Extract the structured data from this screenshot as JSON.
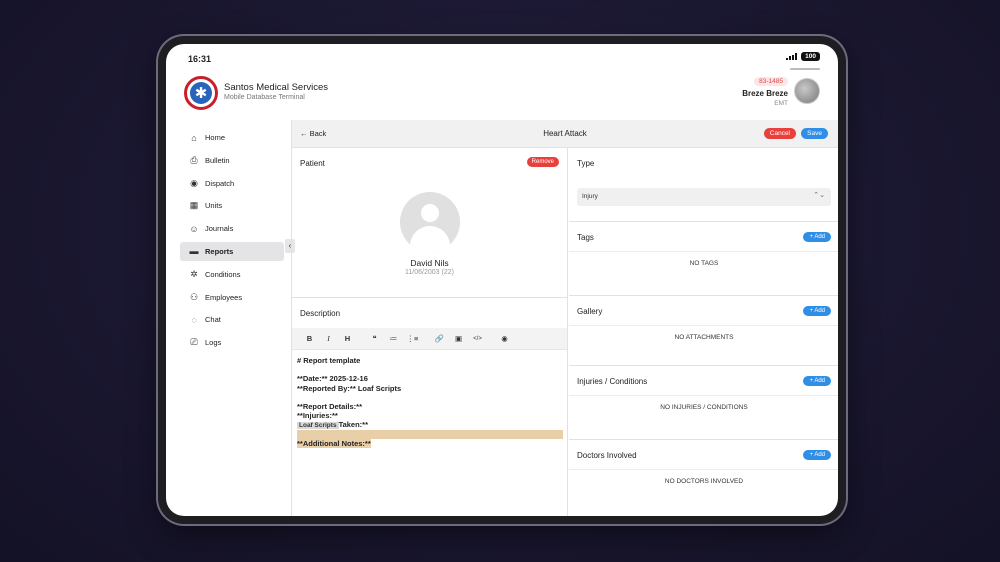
{
  "status": {
    "time": "16:31",
    "battery": "100"
  },
  "header": {
    "org_name": "Santos Medical Services",
    "org_subtitle": "Mobile Database Terminal",
    "user_badge": "83-1485",
    "user_name": "Breze Breze",
    "user_role": "EMT"
  },
  "sidebar": {
    "items": [
      {
        "label": "Home",
        "icon": "home-icon"
      },
      {
        "label": "Bulletin",
        "icon": "bookmark-icon"
      },
      {
        "label": "Dispatch",
        "icon": "broadcast-icon"
      },
      {
        "label": "Units",
        "icon": "grid-icon"
      },
      {
        "label": "Journals",
        "icon": "user-icon"
      },
      {
        "label": "Reports",
        "icon": "folder-icon",
        "active": true
      },
      {
        "label": "Conditions",
        "icon": "gear-icon"
      },
      {
        "label": "Employees",
        "icon": "users-icon"
      },
      {
        "label": "Chat",
        "icon": "chat-icon"
      },
      {
        "label": "Logs",
        "icon": "printer-icon"
      }
    ]
  },
  "titlebar": {
    "back": "Back",
    "title": "Heart Attack",
    "cancel": "Cancel",
    "save": "Save"
  },
  "patient": {
    "title": "Patient",
    "remove": "Remove",
    "name": "David Nils",
    "dob": "11/06/2003 (22)"
  },
  "description": {
    "title": "Description",
    "toolbar": [
      "B",
      "I",
      "H",
      "❝",
      "≔",
      "⋮≡",
      "🔗",
      "▣",
      "</>",
      "◉"
    ],
    "lines": {
      "l1": "# Report template",
      "l2": "**Date:** 2025-12-16",
      "l3": "**Reported By:** Loaf Scripts",
      "l4": "**Report Details:**",
      "l5": "**Injuries:**",
      "tooltip": "Loaf Scripts",
      "l6b": "Taken:**",
      "l7": "**Additional Notes:**"
    }
  },
  "type": {
    "title": "Type",
    "value": "Injury"
  },
  "tags": {
    "title": "Tags",
    "add": "+ Add",
    "empty": "NO TAGS"
  },
  "gallery": {
    "title": "Gallery",
    "add": "+ Add",
    "empty": "NO ATTACHMENTS"
  },
  "injuries": {
    "title": "Injuries / Conditions",
    "add": "+ Add",
    "empty": "NO INJURIES / CONDITIONS"
  },
  "doctors": {
    "title": "Doctors Involved",
    "add": "+ Add",
    "empty": "NO DOCTORS INVOLVED"
  }
}
